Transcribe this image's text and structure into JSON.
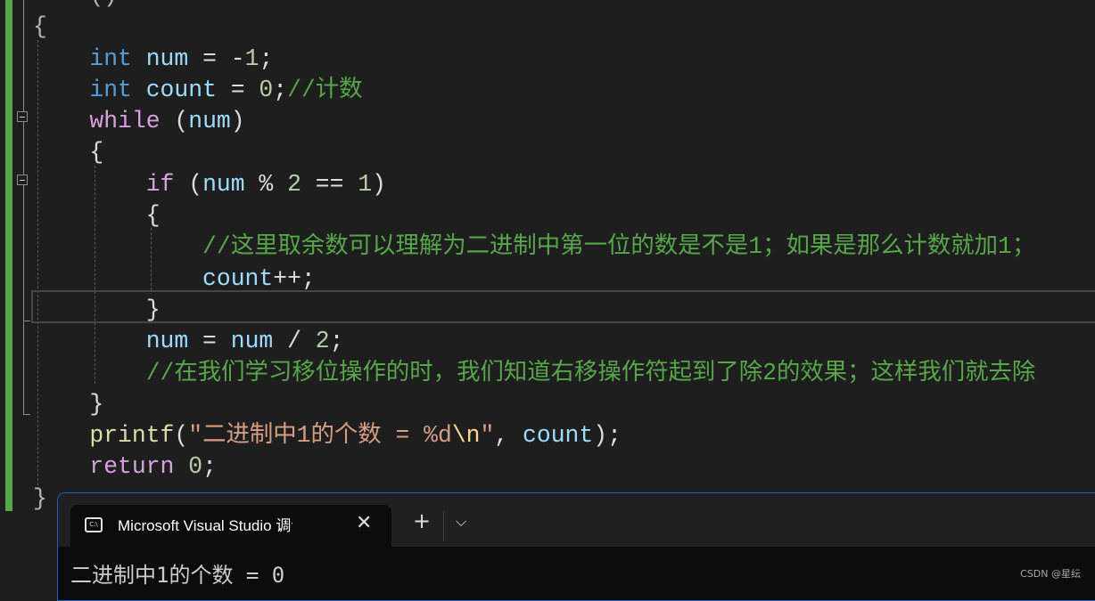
{
  "editor": {
    "lines": [
      [
        {
          "t": "    ()",
          "c": "pun"
        }
      ],
      [
        {
          "t": "{",
          "c": "pun"
        }
      ],
      [
        {
          "t": "    "
        },
        {
          "t": "int",
          "c": "kw"
        },
        {
          "t": " "
        },
        {
          "t": "num",
          "c": "var"
        },
        {
          "t": " = -"
        },
        {
          "t": "1",
          "c": "num"
        },
        {
          "t": ";"
        }
      ],
      [
        {
          "t": "    "
        },
        {
          "t": "int",
          "c": "kw"
        },
        {
          "t": " "
        },
        {
          "t": "count",
          "c": "var"
        },
        {
          "t": " = "
        },
        {
          "t": "0",
          "c": "num"
        },
        {
          "t": ";"
        },
        {
          "t": "//计数",
          "c": "cmt"
        }
      ],
      [
        {
          "t": "    "
        },
        {
          "t": "while",
          "c": "ctl"
        },
        {
          "t": " ("
        },
        {
          "t": "num",
          "c": "var"
        },
        {
          "t": ")"
        }
      ],
      [
        {
          "t": "    {"
        }
      ],
      [
        {
          "t": "        "
        },
        {
          "t": "if",
          "c": "ctl"
        },
        {
          "t": " ("
        },
        {
          "t": "num",
          "c": "var"
        },
        {
          "t": " % "
        },
        {
          "t": "2",
          "c": "num"
        },
        {
          "t": " == "
        },
        {
          "t": "1",
          "c": "num"
        },
        {
          "t": ")"
        }
      ],
      [
        {
          "t": "        {"
        }
      ],
      [
        {
          "t": "            "
        },
        {
          "t": "//这里取余数可以理解为二进制中第一位的数是不是1；如果是那么计数就加1；",
          "c": "cmt"
        }
      ],
      [
        {
          "t": "            "
        },
        {
          "t": "count",
          "c": "var"
        },
        {
          "t": "++;"
        }
      ],
      [
        {
          "t": "        }"
        }
      ],
      [
        {
          "t": "        "
        },
        {
          "t": "num",
          "c": "var"
        },
        {
          "t": " = "
        },
        {
          "t": "num",
          "c": "var"
        },
        {
          "t": " / "
        },
        {
          "t": "2",
          "c": "num"
        },
        {
          "t": ";"
        }
      ],
      [
        {
          "t": "        "
        },
        {
          "t": "//在我们学习移位操作的时，我们知道右移操作符起到了除2的效果；这样我们就去除",
          "c": "cmt"
        }
      ],
      [
        {
          "t": "    }"
        }
      ],
      [
        {
          "t": "    "
        },
        {
          "t": "printf",
          "c": "fn"
        },
        {
          "t": "("
        },
        {
          "t": "\"二进制中1的个数 = %d",
          "c": "str"
        },
        {
          "t": "\\n",
          "c": "esc"
        },
        {
          "t": "\"",
          "c": "str"
        },
        {
          "t": ", "
        },
        {
          "t": "count",
          "c": "var"
        },
        {
          "t": ");"
        }
      ],
      [
        {
          "t": "    "
        },
        {
          "t": "return",
          "c": "ctl"
        },
        {
          "t": " "
        },
        {
          "t": "0",
          "c": "num"
        },
        {
          "t": ";"
        }
      ],
      [
        {
          "t": "}",
          "c": "pun"
        }
      ]
    ]
  },
  "terminal": {
    "tab_icon_text": "C:\\",
    "tab_title": "Microsoft Visual Studio 调试控",
    "close_glyph": "✕",
    "new_tab_glyph": "+",
    "dropdown_glyph": "⌵",
    "output": "二进制中1的个数 = 0"
  },
  "watermark": "CSDN @星纭"
}
